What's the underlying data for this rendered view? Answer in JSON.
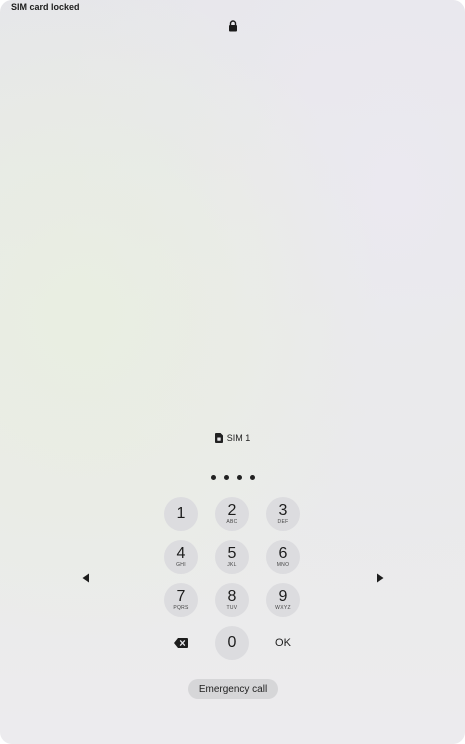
{
  "status_bar": {
    "title": "SIM card locked"
  },
  "sim": {
    "label": "SIM 1"
  },
  "pin": {
    "entered_digits": 4
  },
  "keypad": {
    "keys": [
      {
        "digit": "1",
        "letters": ""
      },
      {
        "digit": "2",
        "letters": "ABC"
      },
      {
        "digit": "3",
        "letters": "DEF"
      },
      {
        "digit": "4",
        "letters": "GHI"
      },
      {
        "digit": "5",
        "letters": "JKL"
      },
      {
        "digit": "6",
        "letters": "MNO"
      },
      {
        "digit": "7",
        "letters": "PQRS"
      },
      {
        "digit": "8",
        "letters": "TUV"
      },
      {
        "digit": "9",
        "letters": "WXYZ"
      }
    ],
    "zero": "0",
    "ok": "OK"
  },
  "emergency": {
    "label": "Emergency call"
  },
  "icons": {
    "lock": "lock-icon",
    "sim": "sim-card-icon",
    "backspace": "backspace-icon",
    "left": "arrow-left-icon",
    "right": "arrow-right-icon"
  }
}
